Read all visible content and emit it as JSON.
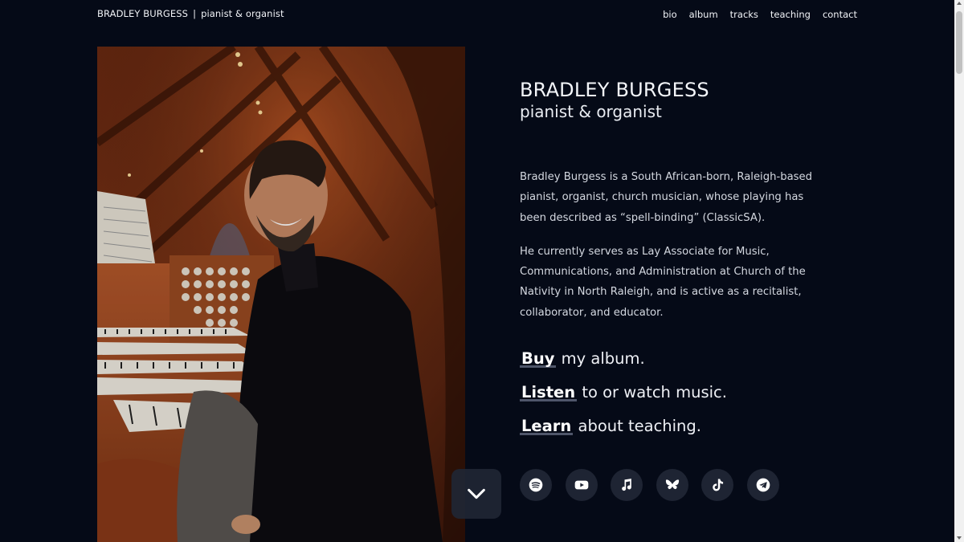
{
  "header": {
    "brand_name": "BRADLEY BURGESS",
    "brand_separator": "|",
    "brand_tagline": "pianist & organist",
    "nav": [
      {
        "label": "bio"
      },
      {
        "label": "album"
      },
      {
        "label": "tracks"
      },
      {
        "label": "teaching"
      },
      {
        "label": "contact"
      }
    ]
  },
  "hero": {
    "name": "BRADLEY BURGESS",
    "subtitle": "pianist & organist",
    "bio": [
      "Bradley Burgess is a South African-born, Raleigh-based pianist, organist, church musician, whose playing has been described as “spell-binding” (ClassicSA).",
      "He currently serves as Lay Associate for Music, Communications, and Administration at Church of the Nativity in North Raleigh, and is active as a recitalist, collaborator, and educator."
    ],
    "cta": [
      {
        "link": "Buy",
        "rest": " my album."
      },
      {
        "link": "Listen",
        "rest": " to or watch music."
      },
      {
        "link": "Learn",
        "rest": " about teaching."
      }
    ]
  },
  "socials": [
    {
      "icon": "spotify-icon"
    },
    {
      "icon": "youtube-icon"
    },
    {
      "icon": "music-note-icon"
    },
    {
      "icon": "bluesky-icon"
    },
    {
      "icon": "tiktok-icon"
    },
    {
      "icon": "telegram-icon"
    }
  ],
  "scroll_down": {
    "icon": "chevron-down-icon"
  },
  "colors": {
    "background": "#050a17",
    "text": "#e9ecf2",
    "social_button": "#1e2433",
    "underline": "#8c96af"
  }
}
